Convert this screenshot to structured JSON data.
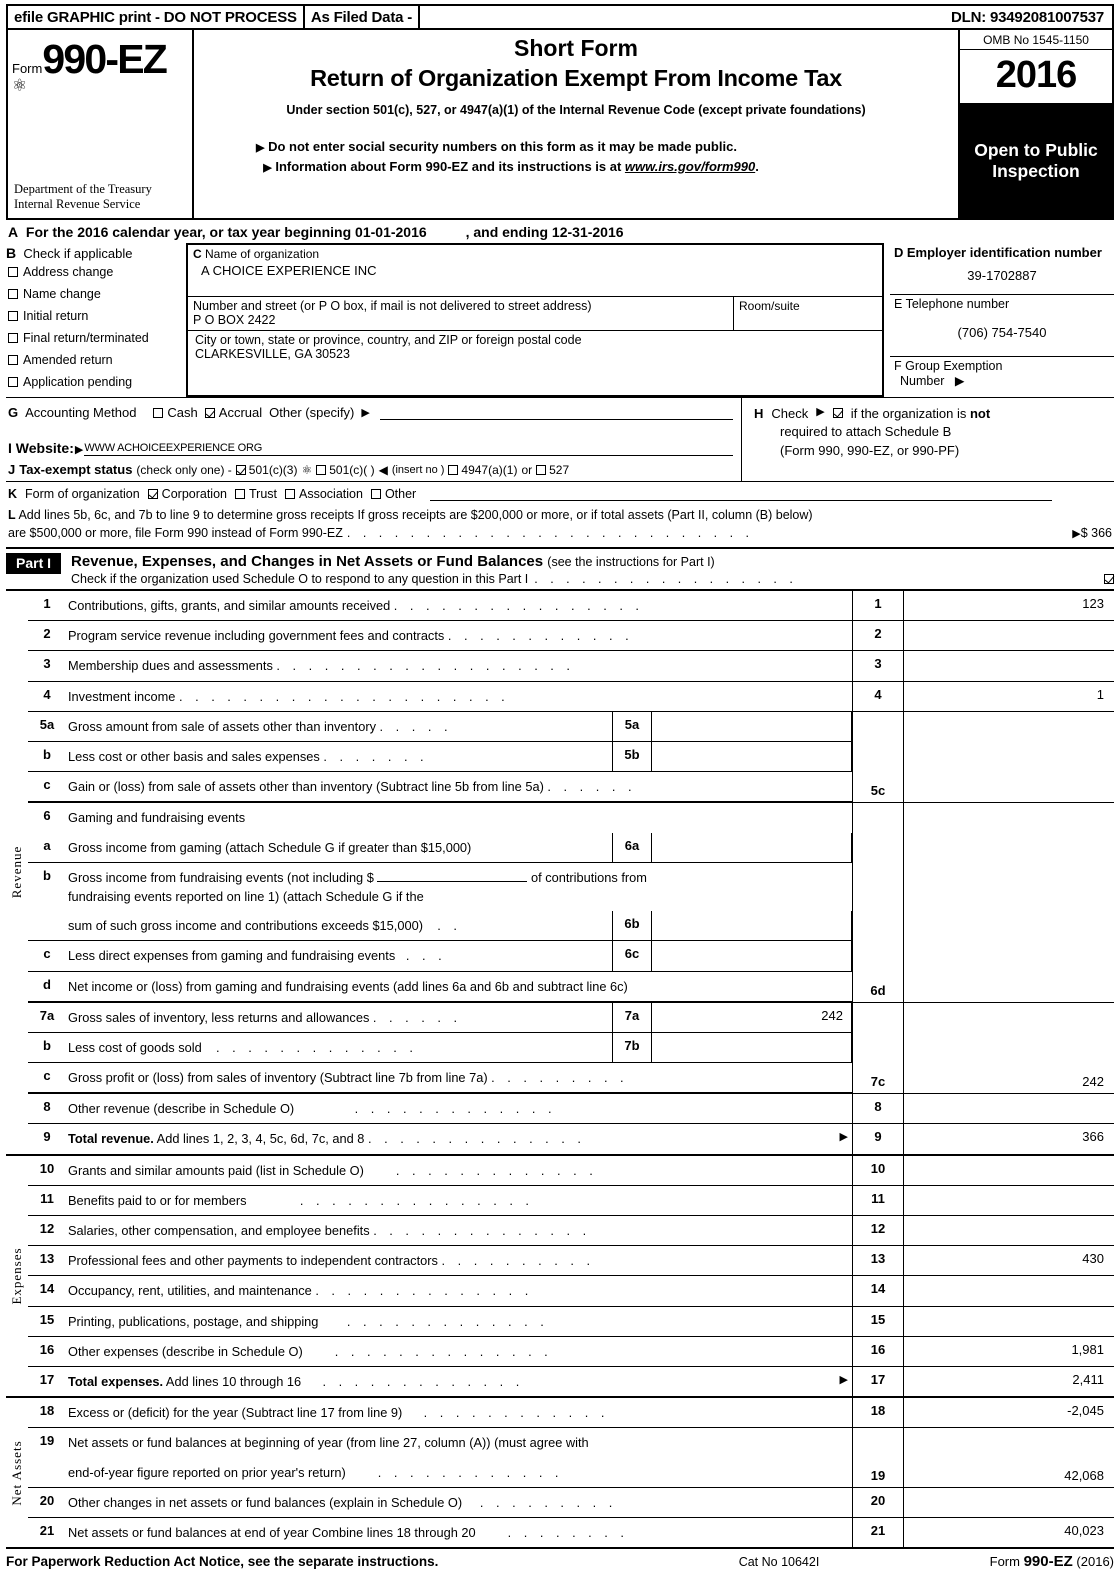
{
  "efile": {
    "print_notice": "efile GRAPHIC print - DO NOT PROCESS",
    "as_filed": "As Filed Data -",
    "dln": "DLN: 93492081007537"
  },
  "masthead": {
    "form_label": "Form",
    "form_number": "990-EZ",
    "form_glyph": "⚛",
    "department": "Department of the Treasury",
    "agency": "Internal Revenue Service",
    "short_form": "Short Form",
    "title": "Return of Organization Exempt From Income Tax",
    "subtitle": "Under section 501(c), 527, or 4947(a)(1) of the Internal Revenue Code (except private foundations)",
    "bullet1": "Do not enter social security numbers on this form as it may be made public.",
    "bullet2_pre": "Information about Form 990-EZ and its instructions is at ",
    "bullet2_link": "www.irs.gov/form990",
    "bullet2_post": ".",
    "omb": "OMB No  1545-1150",
    "year": "2016",
    "open_line1": "Open to Public",
    "open_line2": "Inspection"
  },
  "lineA": {
    "letter": "A",
    "text_pre": "For the 2016 calendar year, or tax year beginning",
    "begin_date": "01-01-2016",
    "text_mid": ", and ending",
    "end_date": "12-31-2016"
  },
  "sectionB": {
    "letter": "B",
    "heading": "Check if applicable",
    "options": [
      {
        "label": "Address change",
        "checked": false
      },
      {
        "label": "Name change",
        "checked": false
      },
      {
        "label": "Initial return",
        "checked": false
      },
      {
        "label": "Final return/terminated",
        "checked": false
      },
      {
        "label": "Amended return",
        "checked": false
      },
      {
        "label": "Application pending",
        "checked": false
      }
    ]
  },
  "sectionC": {
    "letter": "C",
    "name_label": "Name of organization",
    "org_name": "A CHOICE EXPERIENCE INC",
    "street_label": "Number and street (or P  O  box, if mail is not delivered to street address)",
    "room_label": "Room/suite",
    "street": "P O BOX 2422",
    "room": "",
    "city_label": "City or town, state or province, country, and ZIP or foreign postal code",
    "city": "CLARKESVILLE, GA  30523"
  },
  "sectionD": {
    "letter": "D",
    "ein_label": "Employer identification number",
    "ein": "39-1702887",
    "phone_letter": "E",
    "phone_label": "Telephone number",
    "phone": "(706) 754-7540",
    "group_letter": "F",
    "group_label_1": "Group Exemption",
    "group_label_2": "Number",
    "group_arrow": "▶",
    "group_number": ""
  },
  "sectionG": {
    "letter": "G",
    "label": "Accounting Method",
    "cash_label": "Cash",
    "cash_checked": false,
    "accrual_label": "Accrual",
    "accrual_checked": true,
    "other_label": "Other (specify)",
    "other_value": ""
  },
  "sectionH": {
    "letter": "H",
    "check_label": "Check",
    "arrow": "▶",
    "checked": true,
    "line1_pre": "if the organization is ",
    "line1_bold": "not",
    "line2": "required to attach Schedule B",
    "line3": "(Form 990, 990-EZ, or 990-PF)"
  },
  "sectionI": {
    "letter": "I",
    "label": "Website:",
    "arrow": "▶",
    "url": "WWW ACHOICEEXPERIENCE ORG"
  },
  "sectionJ": {
    "letter": "J",
    "label": "Tax-exempt status",
    "note": "(check only one) -",
    "opt1": "501(c)(3)",
    "opt1_checked": true,
    "glyph": "⚛",
    "opt2": "501(c)(   )",
    "opt2_checked": false,
    "insert": "(insert no )",
    "insert_arrow": "◀",
    "opt3": "4947(a)(1)",
    "opt3_checked": false,
    "or": "or",
    "opt4": "527",
    "opt4_checked": false
  },
  "sectionK": {
    "letter": "K",
    "label": "Form of organization",
    "options": [
      {
        "label": "Corporation",
        "checked": true
      },
      {
        "label": "Trust",
        "checked": false
      },
      {
        "label": "Association",
        "checked": false
      },
      {
        "label": "Other",
        "checked": false
      }
    ]
  },
  "sectionL": {
    "letter": "L",
    "line1": "Add lines 5b, 6c, and 7b to line 9 to determine gross receipts  If gross receipts are $200,000 or more, or if total assets (Part II, column (B) below)",
    "line2": "are $500,000 or more, file Form 990 instead of Form 990-EZ",
    "arrow": "▶",
    "amount": "$ 366"
  },
  "partI": {
    "badge": "Part I",
    "title": "Revenue, Expenses, and Changes in Net Assets or Fund Balances",
    "title_note": "(see the instructions for Part I)",
    "check_text": "Check if the organization used Schedule O to respond to any question in this Part I",
    "check_checked": true,
    "rails": {
      "revenue": "Revenue",
      "expenses": "Expenses",
      "net_assets": "Net Assets"
    },
    "revenue_rows": [
      {
        "num": "1",
        "desc": "Contributions, gifts, grants, and similar amounts received",
        "dots": ". . . . . . . . . . . . . . . .",
        "code": "1",
        "amount": "123"
      },
      {
        "num": "2",
        "desc": "Program service revenue including government fees and contracts",
        "dots": ". . . . . . . . . . . .",
        "code": "2",
        "amount": ""
      },
      {
        "num": "3",
        "desc": "Membership dues and assessments",
        "dots": ". . . . . . . . . . . . . . . . . . .",
        "code": "3",
        "amount": ""
      },
      {
        "num": "4",
        "desc": "Investment income",
        "dots": ". . . . . . . . . . . . . . . . . . . . .",
        "code": "4",
        "amount": "1"
      }
    ],
    "row5a": {
      "num": "5a",
      "desc": "Gross amount from sale of assets other than inventory",
      "dots": ". . . . .",
      "box": "5a",
      "value": ""
    },
    "row5b": {
      "num": "b",
      "desc": "Less  cost or other basis and sales expenses",
      "dots": ". . . . . . .",
      "box": "5b",
      "value": ""
    },
    "row5c": {
      "num": "c",
      "desc": "Gain or (loss) from sale of assets other than inventory (Subtract line 5b from line 5a)",
      "dots": ". . . . . .",
      "code": "5c",
      "amount": ""
    },
    "row6": {
      "num": "6",
      "desc": "Gaming and fundraising events"
    },
    "row6a": {
      "num": "a",
      "desc": "Gross income from gaming (attach Schedule G if greater than $15,000)",
      "box": "6a",
      "value": ""
    },
    "row6b": {
      "num": "b",
      "line1_pre": "Gross income from fundraising events (not including $",
      "line1_post": "of contributions from",
      "line2": "fundraising events reported on line 1) (attach Schedule G if the",
      "line3": "sum of such gross income and contributions exceeds $15,000)",
      "dots": ". .",
      "box": "6b",
      "value": ""
    },
    "row6c": {
      "num": "c",
      "desc": "Less  direct expenses from gaming and fundraising events",
      "dots": ". . .",
      "box": "6c",
      "value": ""
    },
    "row6d": {
      "num": "d",
      "desc": "Net income or (loss) from gaming and fundraising events (add lines 6a and 6b and subtract line 6c)",
      "code": "6d",
      "amount": ""
    },
    "row7a": {
      "num": "7a",
      "desc": "Gross sales of inventory, less returns and allowances",
      "dots": ". . . . . .",
      "box": "7a",
      "value": "242"
    },
    "row7b": {
      "num": "b",
      "desc": "Less  cost of goods sold",
      "dots": ". . . . . . . . . . . . .",
      "box": "7b",
      "value": ""
    },
    "row7c": {
      "num": "c",
      "desc": "Gross profit or (loss) from sales of inventory (Subtract line 7b from line 7a)",
      "dots": ". . . . . . . . .",
      "code": "7c",
      "amount": "242"
    },
    "row8": {
      "num": "8",
      "desc": "Other revenue (describe in Schedule O)",
      "dots": ". . . . . . . . . . . . .",
      "code": "8",
      "amount": ""
    },
    "row9": {
      "num": "9",
      "desc_bold": "Total revenue.",
      "desc": " Add lines 1, 2, 3, 4, 5c, 6d, 7c, and 8",
      "dots": ". . . . . . . . . . . . . .",
      "arrow": "▶",
      "code": "9",
      "amount": "366"
    },
    "expense_rows": [
      {
        "num": "10",
        "desc": "Grants and similar amounts paid (list in Schedule O)",
        "dots": ". . . . . . . . . . . . .",
        "code": "10",
        "amount": ""
      },
      {
        "num": "11",
        "desc": "Benefits paid to or for members",
        "dots": ". . . . . . . . . . . . . . .",
        "code": "11",
        "amount": ""
      },
      {
        "num": "12",
        "desc": "Salaries, other compensation, and employee benefits",
        "dots": ". . . . . . . . . . . . . .",
        "code": "12",
        "amount": ""
      },
      {
        "num": "13",
        "desc": "Professional fees and other payments to independent contractors",
        "dots": ". . . . . . . . . .",
        "code": "13",
        "amount": "430"
      },
      {
        "num": "14",
        "desc": "Occupancy, rent, utilities, and maintenance",
        "dots": ". . . . . . . . . . . . . .",
        "code": "14",
        "amount": ""
      },
      {
        "num": "15",
        "desc": "Printing, publications, postage, and shipping",
        "dots": ". . . . . . . . . . . . .",
        "code": "15",
        "amount": ""
      },
      {
        "num": "16",
        "desc": "Other expenses (describe in Schedule O)",
        "dots": ". . . . . . . . . . . . . .",
        "code": "16",
        "amount": "1,981"
      }
    ],
    "row17": {
      "num": "17",
      "desc_bold": "Total expenses.",
      "desc": " Add lines 10 through 16",
      "dots": ". . . . . . . . . . . . .",
      "arrow": "▶",
      "code": "17",
      "amount": "2,411"
    },
    "row18": {
      "num": "18",
      "desc": "Excess or (deficit) for the year (Subtract line 17 from line 9)",
      "dots": ". . . . . . . . . . . .",
      "code": "18",
      "amount": "-2,045"
    },
    "row19": {
      "num": "19",
      "line1": "Net assets or fund balances at beginning of year (from line 27, column (A)) (must agree with",
      "line2": "end-of-year figure reported on prior year's return)",
      "dots": ". . . . . . . . . . . .",
      "code": "19",
      "amount": "42,068"
    },
    "row20": {
      "num": "20",
      "desc": "Other changes in net assets or fund balances (explain in Schedule O)",
      "dots": ". . . . . . . . .",
      "code": "20",
      "amount": ""
    },
    "row21": {
      "num": "21",
      "desc": "Net assets or fund balances at end of year  Combine lines 18 through 20",
      "dots": ". . . . . . . .",
      "code": "21",
      "amount": "40,023"
    }
  },
  "footer": {
    "notice": "For Paperwork Reduction Act Notice, see the separate instructions.",
    "cat": "Cat  No  10642I",
    "form_label": "Form",
    "form_number": "990-EZ",
    "year": "(2016)"
  }
}
